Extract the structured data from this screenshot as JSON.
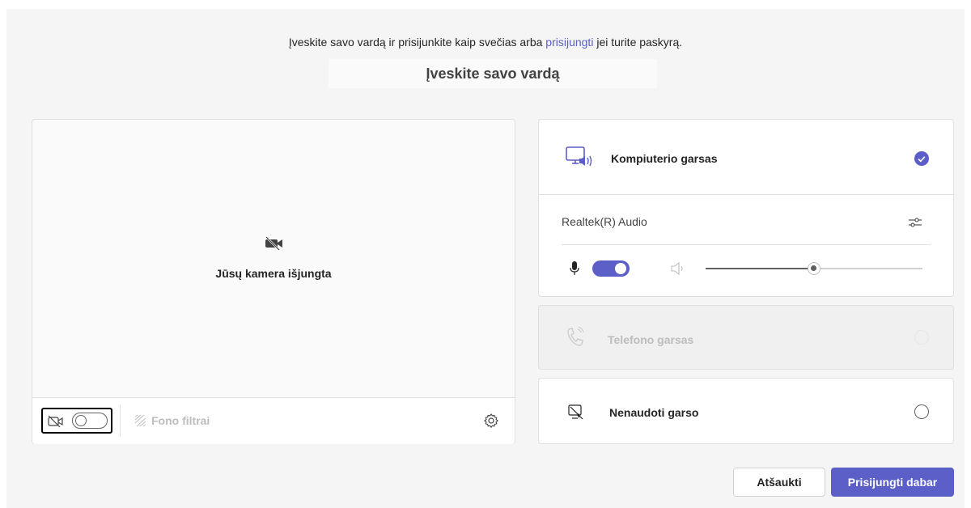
{
  "intro": {
    "text_before": "Įveskite savo vardą ir prisijunkite kaip svečias arba",
    "link": "prisijungti",
    "text_after": "jei turite paskyrą."
  },
  "name_input": {
    "value": "",
    "placeholder": "Įveskite savo vardą"
  },
  "video": {
    "camera_off_label": "Jūsų kamera išjungta",
    "camera_toggle_on": false,
    "background_filters_label": "Fono filtrai"
  },
  "audio": {
    "computer": {
      "label": "Kompiuterio garsas",
      "selected": true,
      "device": "Realtek(R) Audio",
      "mic_on": true,
      "volume": 0.5
    },
    "phone": {
      "label": "Telefono garsas",
      "disabled": true
    },
    "none": {
      "label": "Nenaudoti garso",
      "selected": false
    }
  },
  "buttons": {
    "cancel": "Atšaukti",
    "join": "Prisijungti dabar"
  },
  "colors": {
    "accent": "#5b5fc7",
    "background": "#f5f5f5"
  }
}
